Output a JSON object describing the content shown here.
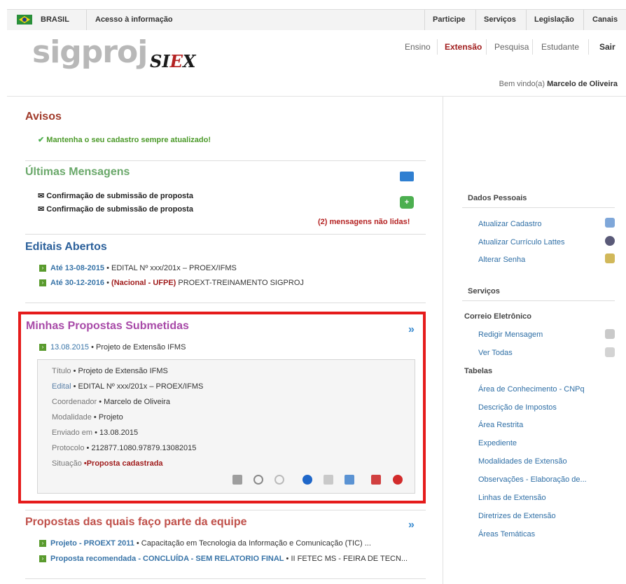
{
  "govbar": {
    "country": "BRASIL",
    "access": "Acesso à informação",
    "links": [
      "Participe",
      "Serviços",
      "Legislação",
      "Canais"
    ]
  },
  "logo": {
    "sig": "sigproj",
    "siex_a": "SI",
    "siex_b": "E",
    "siex_c": "X"
  },
  "topnav": {
    "items": [
      "Ensino",
      "Extensão",
      "Pesquisa",
      "Estudante",
      "Sair"
    ],
    "active": "Extensão"
  },
  "welcome": {
    "prefix": "Bem vindo(a)",
    "user": "Marcelo de Oliveira"
  },
  "avisos": {
    "title": "Avisos",
    "items": [
      "Mantenha o seu cadastro sempre atualizado!"
    ]
  },
  "mensagens": {
    "title": "Últimas Mensagens",
    "items": [
      "Confirmação de submissão de proposta",
      "Confirmação de submissão de proposta"
    ],
    "unread": "(2) mensagens não lidas!"
  },
  "editais": {
    "title": "Editais Abertos",
    "items": [
      {
        "date": "Até 13-08-2015",
        "sep": " • ",
        "text": "EDITAL Nº xxx/201x – PROEX/IFMS"
      },
      {
        "date": "Até 30-12-2016",
        "sep": " • ",
        "tag": "(Nacional - UFPE)",
        "text": " PROEXT-TREINAMENTO SIGPROJ"
      }
    ]
  },
  "minhas": {
    "title": "Minhas Propostas Submetidas",
    "date": "13.08.2015",
    "name": " • Projeto de Extensão IFMS",
    "details": [
      {
        "k": "Título",
        "v": " • Projeto de Extensão IFMS"
      },
      {
        "k": "Edital",
        "v": " • EDITAL Nº xxx/201x – PROEX/IFMS"
      },
      {
        "k": "Coordenador",
        "v": " • Marcelo de Oliveira"
      },
      {
        "k": "Modalidade",
        "v": " • Projeto"
      },
      {
        "k": "Enviado em",
        "v": " • 13.08.2015"
      },
      {
        "k": "Protocolo",
        "v": " • 212877.1080.97879.13082015"
      },
      {
        "k": "Situação",
        "v": " •Proposta cadastrada"
      }
    ]
  },
  "equipe": {
    "title": "Propostas das quais faço parte da equipe",
    "items": [
      {
        "a": "Projeto - PROEXT 2011",
        "b": " • Capacitação em Tecnologia da Informação e Comunicação (TIC) ..."
      },
      {
        "a": "Proposta recomendada - CONCLUÍDA - SEM RELATORIO FINAL",
        "b": " • II FETEC MS - FEIRA DE TECN..."
      }
    ]
  },
  "sidebar": {
    "dados_title": "Dados Pessoais",
    "dados": [
      "Atualizar Cadastro",
      "Atualizar Currículo Lattes",
      "Alterar Senha"
    ],
    "servicos_title": "Serviços",
    "correio_title": "Correio Eletrônico",
    "correio": [
      "Redigir Mensagem",
      "Ver Todas"
    ],
    "tabelas_title": "Tabelas",
    "tabelas": [
      "Área de Conhecimento - CNPq",
      "Descrição de Impostos",
      "Área Restrita",
      "Expediente",
      "Modalidades de Extensão",
      "Observações - Elaboração de...",
      "Linhas de Extensão",
      "Diretrizes de Extensão",
      "Áreas Temáticas"
    ]
  },
  "colors": {
    "brand_red": "#a01d1d",
    "link_blue": "#2f6fa6",
    "highlight": "#e51b1b"
  }
}
